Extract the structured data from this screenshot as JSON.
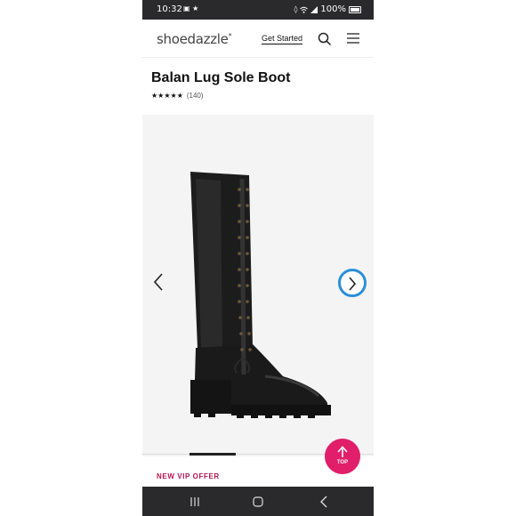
{
  "status_bar": {
    "time": "10:32",
    "battery": "100%",
    "left_icons": "▣ ★",
    "icons": [
      "mute-icon",
      "wifi-icon",
      "signal-icon",
      "battery-icon"
    ]
  },
  "header": {
    "logo": "shoedazzle",
    "logo_mark": "*",
    "get_started": "Get Started",
    "icons": [
      "search-icon",
      "menu-icon"
    ]
  },
  "product": {
    "title": "Balan Lug Sole Boot",
    "stars": "★★★★★",
    "rating_value": 4.5,
    "review_count": "(140)"
  },
  "gallery": {
    "background": "#f4f4f4",
    "active_image_index": 1,
    "image_description_icon": "boot-image",
    "arrows": [
      "chevron-left-icon",
      "chevron-right-icon"
    ],
    "next_ring_color": "#2b8fd6"
  },
  "promo": {
    "label": "NEW VIP OFFER",
    "color": "#b3124d"
  },
  "top_button": {
    "label": "TOP",
    "color": "#e01e6a"
  },
  "nav_bar": {
    "icons": [
      "recent-apps-icon",
      "home-icon",
      "back-icon"
    ]
  }
}
